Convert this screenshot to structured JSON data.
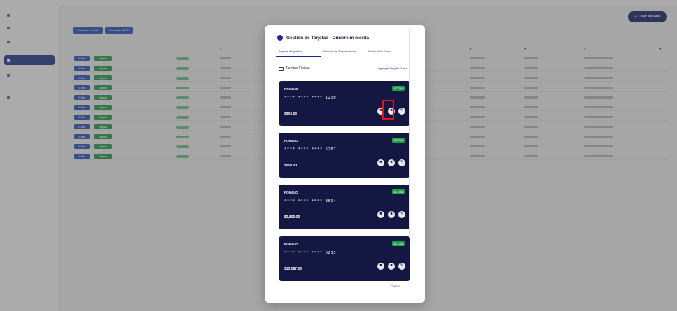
{
  "background": {
    "new_user_label": "+ Crear usuario",
    "export_excel_label": "Exportar a Excel",
    "export_pdf_label": "Exportar a PDF",
    "edit_label": "Editar",
    "assign_label": "Tarjetas"
  },
  "modal": {
    "title": "Gestión de Tarjetas - Omarrelm morita",
    "tabs": [
      {
        "label": "Tarjetas Asignadas"
      },
      {
        "label": "Historial de Transacciones"
      },
      {
        "label": "Solicitud de Saldo"
      }
    ],
    "section_title": "Tarjetas Físicas",
    "add_card_label": "+ Agregar Tarjeta Física",
    "close_label": "Cerrar",
    "cards": [
      {
        "brand": "POMELO",
        "status": "ACTIVA",
        "number": "**** **** **** 1230",
        "balance": "$900.00"
      },
      {
        "brand": "POMELO",
        "status": "ACTIVA",
        "number": "**** **** **** 5287",
        "balance": "$950.00"
      },
      {
        "brand": "POMELO",
        "status": "ACTIVA",
        "number": "**** **** **** 3694",
        "balance": "$3,800.00"
      },
      {
        "brand": "POMELO",
        "status": "ACTIVA",
        "number": "**** **** **** 6215",
        "balance": "$13,587.00"
      }
    ]
  },
  "colors": {
    "accent": "#1f2a8a",
    "card_bg": "#141741",
    "status_active": "#22a049",
    "highlight": "#e0141d"
  }
}
